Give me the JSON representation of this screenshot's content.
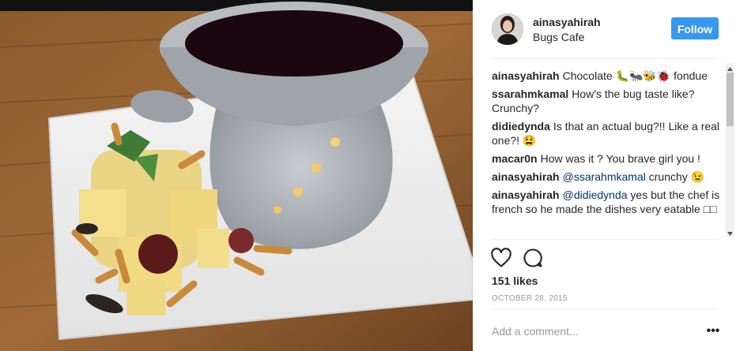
{
  "post": {
    "username": "ainasyahirah",
    "location": "Bugs Cafe",
    "follow_label": "Follow",
    "likes": "151 likes",
    "date": "OCTOBER 28, 2015",
    "add_comment_placeholder": "Add a comment...",
    "more_label": "•••"
  },
  "comments": [
    {
      "user": "ainasyahirah",
      "pre": "Chocolate ",
      "mention": "",
      "post": "🐛🐜🐝🐞 fondue"
    },
    {
      "user": "ssarahmkamal",
      "pre": "How's the bug taste like? Crunchy?",
      "mention": "",
      "post": ""
    },
    {
      "user": "didiedynda",
      "pre": "Is that an actual bug?!! Like a real one?! 😫",
      "mention": "",
      "post": ""
    },
    {
      "user": "macar0n",
      "pre": "How was it ? You brave girl you !",
      "mention": "",
      "post": ""
    },
    {
      "user": "ainasyahirah",
      "pre": "",
      "mention": "@ssarahmkamal",
      "post": " crunchy 😉"
    },
    {
      "user": "ainasyahirah",
      "pre": "",
      "mention": "@didiedynda",
      "post": " yes but the chef is french so he made the dishes very eatable □□"
    }
  ],
  "colors": {
    "follow_bg": "#3897f0",
    "mention": "#003569"
  }
}
